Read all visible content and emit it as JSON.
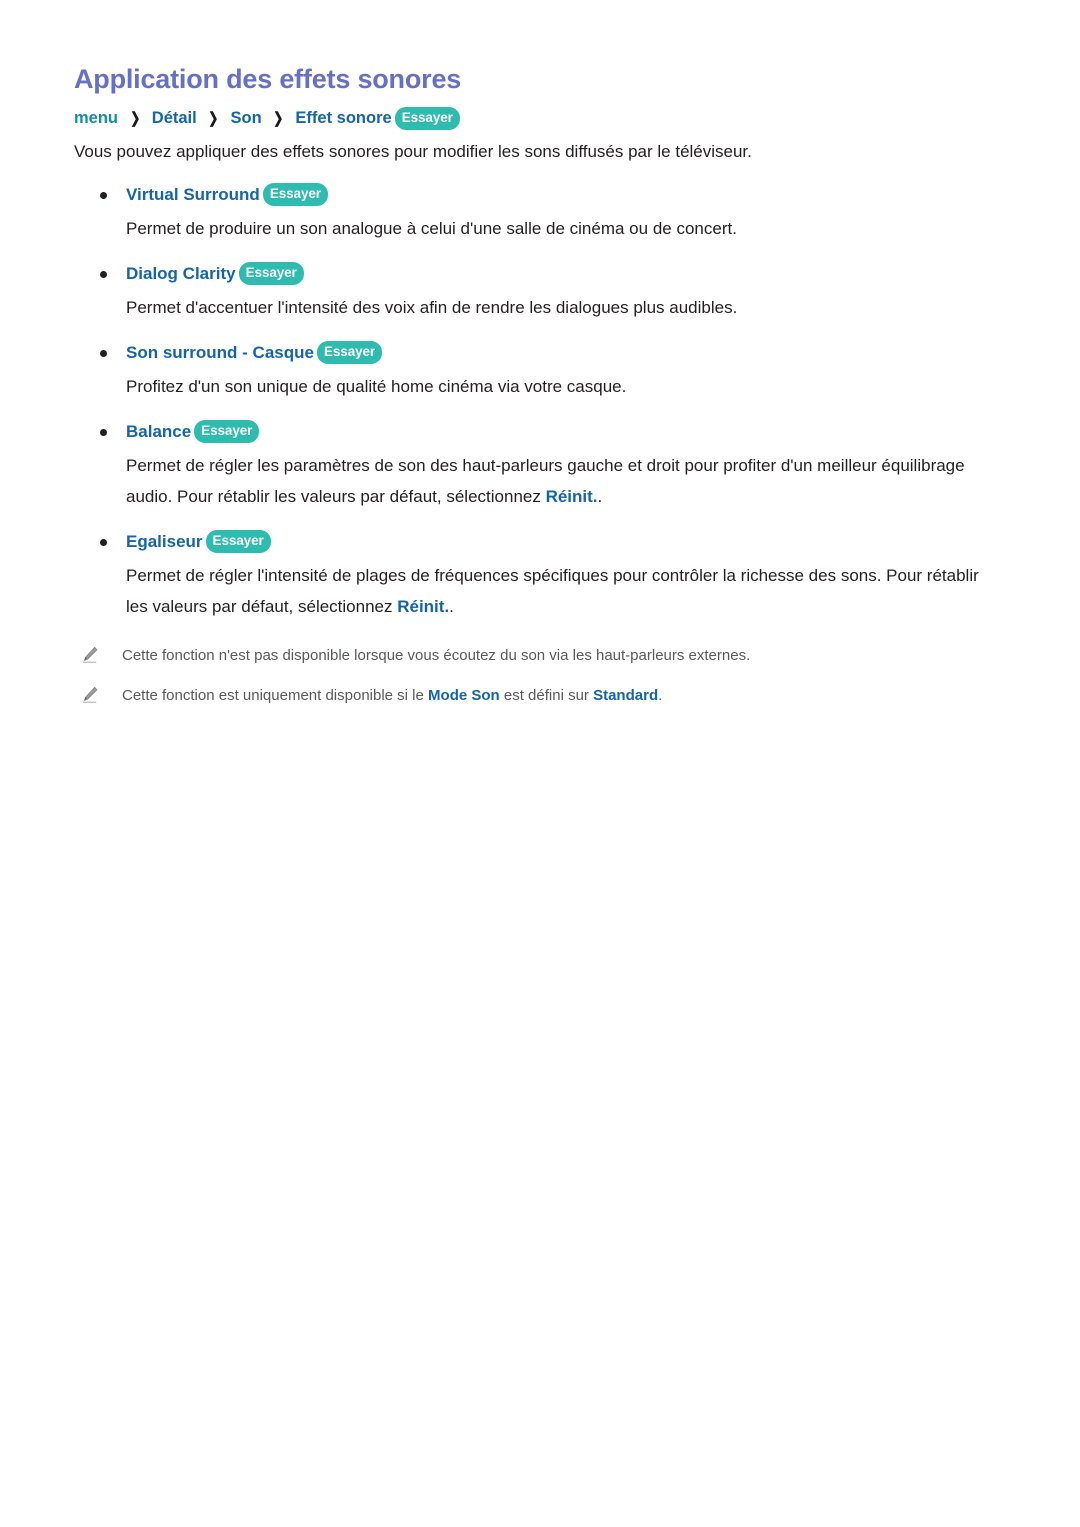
{
  "page": {
    "title": "Application des effets sonores",
    "intro": "Vous pouvez appliquer des effets sonores pour modifier les sons diffusés par le téléviseur."
  },
  "breadcrumb": {
    "root": "menu",
    "separator": "❯",
    "items": [
      "Détail",
      "Son",
      "Effet sonore"
    ],
    "badge": "Essayer"
  },
  "labels": {
    "try_badge": "Essayer"
  },
  "features": [
    {
      "name": "Virtual Surround",
      "badge": "Essayer",
      "desc": "Permet de produire un son analogue à celui d'une salle de cinéma ou de concert."
    },
    {
      "name": "Dialog Clarity",
      "badge": "Essayer",
      "desc": "Permet d'accentuer l'intensité des voix afin de rendre les dialogues plus audibles."
    },
    {
      "name": "Son surround - Casque",
      "badge": "Essayer",
      "desc": "Profitez d'un son unique de qualité home cinéma via votre casque."
    },
    {
      "name": "Balance",
      "badge": "Essayer",
      "desc_pre": "Permet de régler les paramètres de son des haut-parleurs gauche et droit pour profiter d'un meilleur équilibrage audio. Pour rétablir les valeurs par défaut, sélectionnez ",
      "desc_link": "Réinit.",
      "desc_post": "."
    },
    {
      "name": "Egaliseur",
      "badge": "Essayer",
      "desc_pre": "Permet de régler l'intensité de plages de fréquences spécifiques pour contrôler la richesse des sons. Pour rétablir les valeurs par défaut, sélectionnez ",
      "desc_link": "Réinit.",
      "desc_post": "."
    }
  ],
  "notes": [
    {
      "icon": "pencil-icon",
      "text": "Cette fonction n'est pas disponible lorsque vous écoutez du son via les haut-parleurs externes."
    },
    {
      "icon": "pencil-icon",
      "pre": "Cette fonction est uniquement disponible si le ",
      "bold1": "Mode Son",
      "mid": " est défini sur ",
      "bold2": "Standard",
      "post": "."
    }
  ],
  "colors": {
    "title": "#6670c4",
    "breadcrumb_root": "#128ea6",
    "breadcrumb_item": "#1464ab",
    "pill_bg": "#2ebbb0",
    "body_text": "#231f20",
    "note_text": "#58595b"
  }
}
